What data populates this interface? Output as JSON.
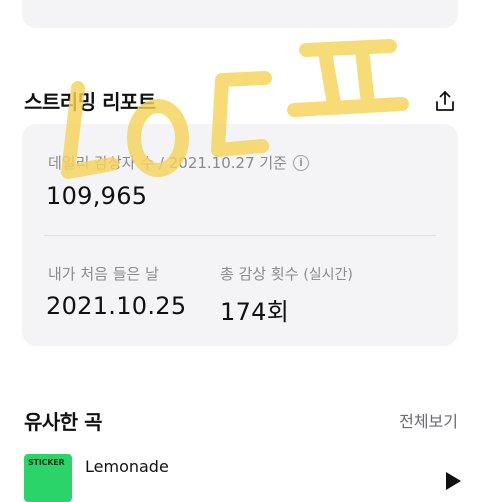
{
  "stream_report": {
    "title": "스트리밍 리포트",
    "share_icon": "share-icon",
    "daily_label": "데일리 감상자 수 / 2021.10.27 기준",
    "info_icon": "info-icon",
    "info_glyph": "i",
    "daily_value": "109,965",
    "first_listen_label": "내가 처음 들은 날",
    "first_listen_value": "2021.10.25",
    "total_label": "총 감상 횟수",
    "total_sub": "(실시간)",
    "total_value": "174회"
  },
  "similar": {
    "title": "유사한 곡",
    "view_all": "전체보기",
    "items": [
      {
        "album_label": "STICKER",
        "title": "Lemonade",
        "play_icon": "play-icon"
      }
    ]
  },
  "handwriting_overlay": {
    "text": "LOㄷㅍ",
    "color": "#f6d45a"
  }
}
